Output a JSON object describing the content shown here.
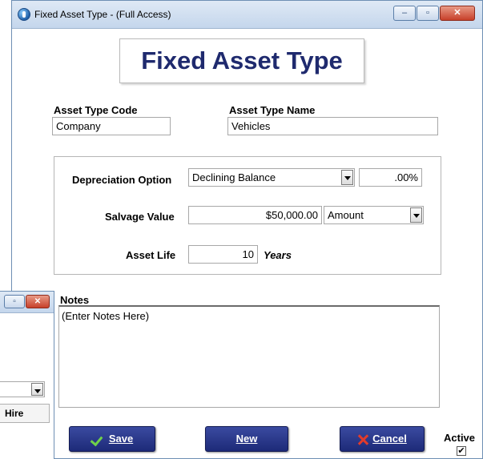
{
  "window": {
    "title": "Fixed Asset Type - (Full Access)",
    "min_glyph": "–",
    "max_glyph": "▫",
    "close_glyph": "✕"
  },
  "banner": "Fixed Asset Type",
  "asset_type_code": {
    "label": "Asset Type Code",
    "value": "Company"
  },
  "asset_type_name": {
    "label": "Asset Type Name",
    "value": "Vehicles"
  },
  "depreciation": {
    "label": "Depreciation Option",
    "selected": "Declining Balance",
    "rate": ".00%"
  },
  "salvage": {
    "label": "Salvage Value",
    "value": "$50,000.00",
    "type_selected": "Amount"
  },
  "asset_life": {
    "label": "Asset Life",
    "value": "10",
    "unit": "Years"
  },
  "notes": {
    "label": "Notes",
    "value": "(Enter Notes Here)"
  },
  "buttons": {
    "save": "Save",
    "new": "New",
    "cancel": "Cancel"
  },
  "active": {
    "label": "Active",
    "checked": true,
    "check_glyph": "✔"
  },
  "background_window": {
    "max_glyph": "▫",
    "close_glyph": "✕",
    "column_header": "Hire"
  },
  "colors": {
    "banner_text": "#1f2a6e",
    "button_bg": "#1d2a78",
    "save_icon": "#6fd14a",
    "cancel_icon": "#e23b2b"
  },
  "icons": {
    "app": "app-globe-icon",
    "save": "check-icon",
    "cancel": "x-icon",
    "dropdown": "chevron-down-icon"
  }
}
